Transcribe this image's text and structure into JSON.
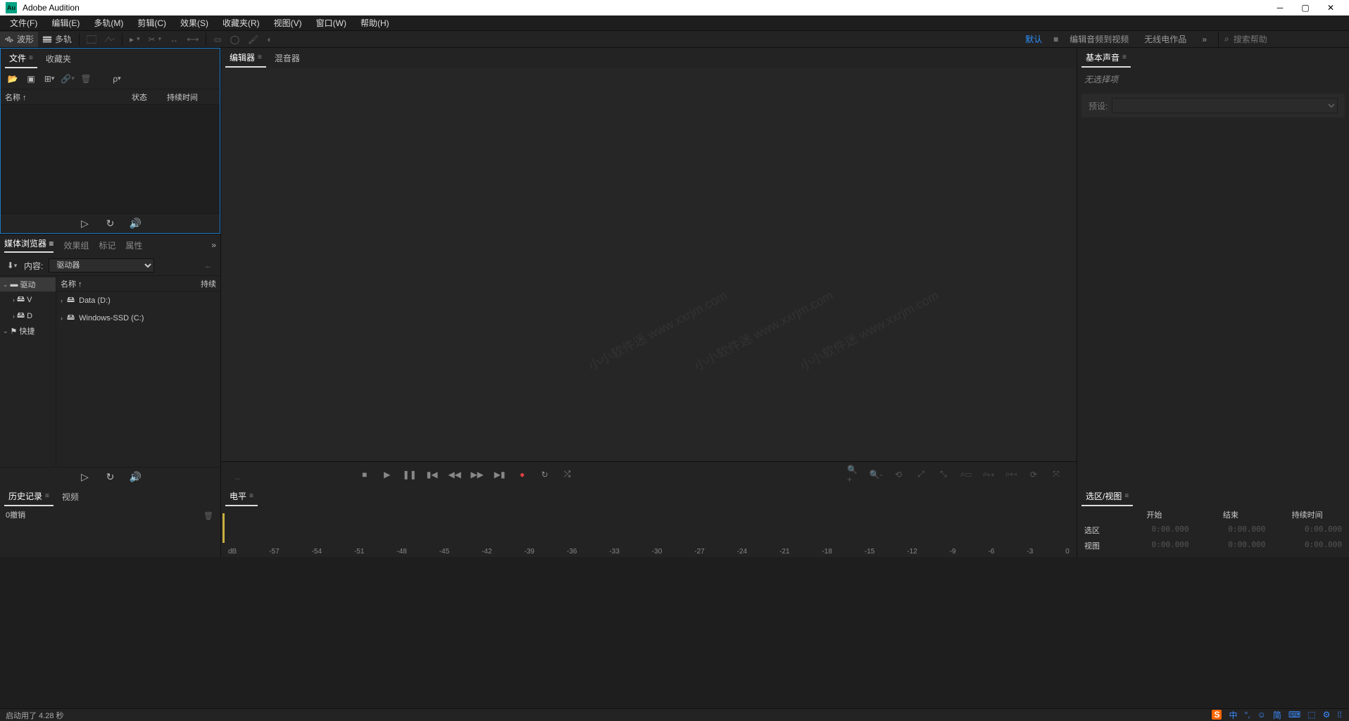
{
  "app": {
    "title": "Adobe Audition"
  },
  "menu": [
    "文件(F)",
    "编辑(E)",
    "多轨(M)",
    "剪辑(C)",
    "效果(S)",
    "收藏夹(R)",
    "视图(V)",
    "窗口(W)",
    "帮助(H)"
  ],
  "toolbar": {
    "waveform": "波形",
    "multitrack": "多轨"
  },
  "workspaces": {
    "default": "默认",
    "edit_to_video": "编辑音频到视频",
    "radio": "无线电作品",
    "more": "»",
    "search_placeholder": "搜索帮助"
  },
  "files_panel": {
    "tab_file": "文件",
    "tab_fav": "收藏夹",
    "col_name": "名称 ↑",
    "col_status": "状态",
    "col_duration": "持续时间"
  },
  "media_panel": {
    "tab_browser": "媒体浏览器",
    "tab_fxgroup": "效果组",
    "tab_marker": "标记",
    "tab_attr": "属性",
    "content_label": "内容:",
    "content_value": "驱动器",
    "tree": [
      {
        "n": "驱动",
        "sel": true
      },
      {
        "n": "V",
        "indent": 1
      },
      {
        "n": "D",
        "indent": 1
      },
      {
        "n": "快捷"
      }
    ],
    "list_hd_name": "名称 ↑",
    "list_hd_dur": "持续",
    "drives": [
      {
        "name": "Data (D:)"
      },
      {
        "name": "Windows-SSD (C:)"
      }
    ]
  },
  "editor": {
    "tab_editor": "编辑器",
    "tab_mixer": "混音器"
  },
  "essential": {
    "title": "基本声音",
    "no_selection": "无选择项",
    "preset_label": "预设:"
  },
  "history": {
    "title": "历史记录",
    "video": "视频",
    "undo0": "0撤销"
  },
  "level": {
    "title": "电平",
    "ticks": [
      "dB",
      "-57",
      "-54",
      "-51",
      "-48",
      "-45",
      "-42",
      "-39",
      "-36",
      "-33",
      "-30",
      "-27",
      "-24",
      "-21",
      "-18",
      "-15",
      "-12",
      "-9",
      "-6",
      "-3",
      "0"
    ]
  },
  "selection": {
    "title": "选区/视图",
    "col_start": "开始",
    "col_end": "结束",
    "col_dur": "持续时间",
    "row_sel": "选区",
    "row_view": "视图",
    "zero": "0:00.000"
  },
  "status": {
    "text": "启动用了 4.28 秒"
  },
  "watermark": "小小软件迷 www.xxrjm.com",
  "ime": {
    "sogou": "S",
    "ch": "中",
    "punc": "°,",
    "full": "☺",
    "simp": "简",
    "panel": "⌨",
    "soft": "⬚",
    "settings": "⚙",
    "menu": "⁞⁞"
  }
}
